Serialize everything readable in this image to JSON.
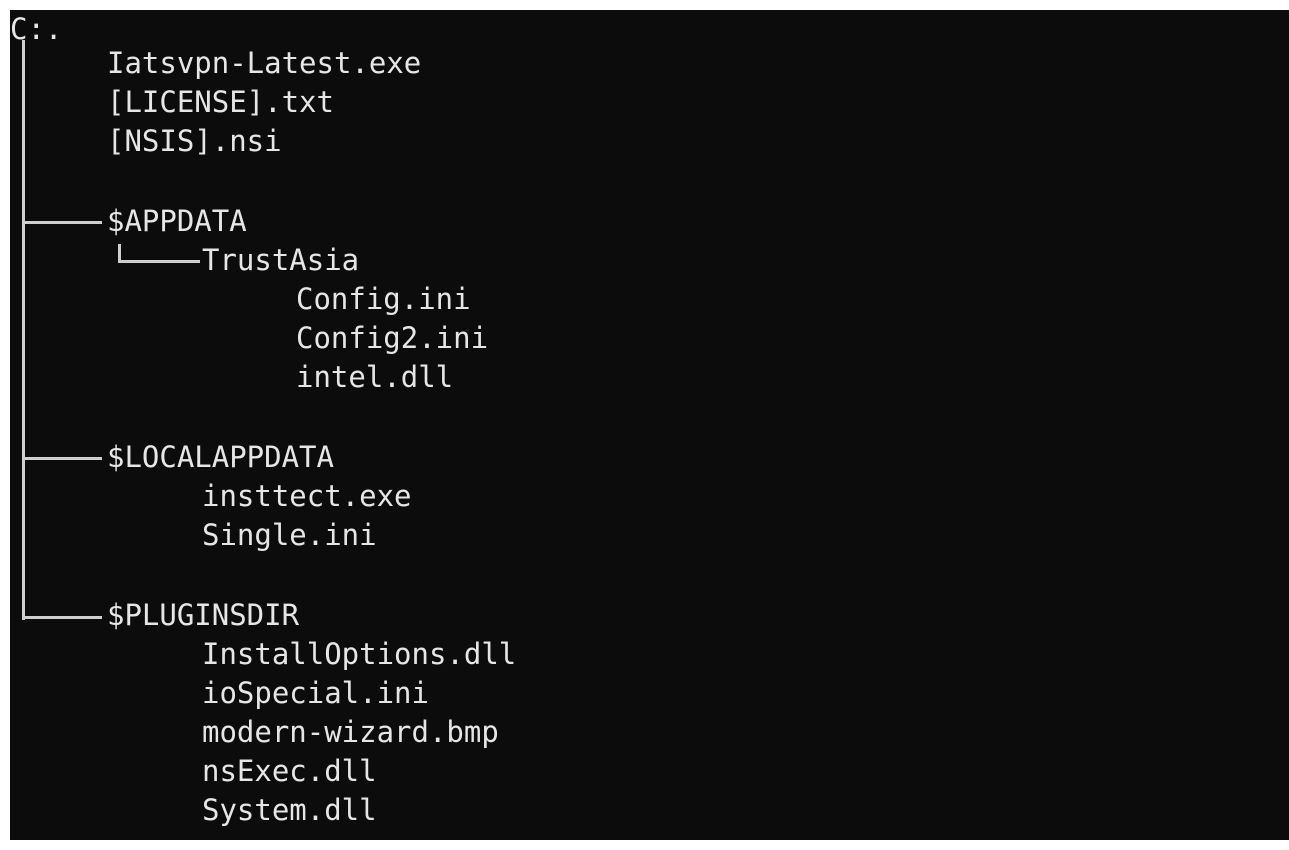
{
  "root": "C:.",
  "files": [
    "Iatsvpn-Latest.exe",
    "[LICENSE].txt",
    "[NSIS].nsi"
  ],
  "appdata": {
    "name": "$APPDATA",
    "subdir": "TrustAsia",
    "files": [
      "Config.ini",
      "Config2.ini",
      "intel.dll"
    ]
  },
  "localappdata": {
    "name": "$LOCALAPPDATA",
    "files": [
      "insttect.exe",
      "Single.ini"
    ]
  },
  "pluginsdir": {
    "name": "$PLUGINSDIR",
    "files": [
      "InstallOptions.dll",
      "ioSpecial.ini",
      "modern-wizard.bmp",
      "nsExec.dll",
      "System.dll"
    ]
  }
}
